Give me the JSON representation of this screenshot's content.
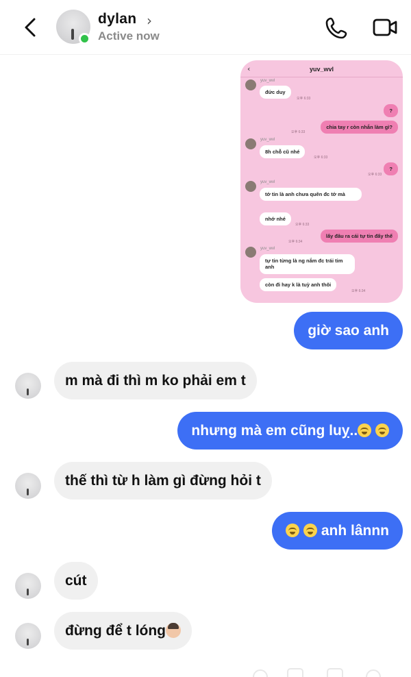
{
  "header": {
    "name": "dylan",
    "status": "Active now"
  },
  "shared_screenshot": {
    "title": "yuv_wvl",
    "messages": [
      {
        "dir": "in",
        "sender": "yuv_wvl",
        "text": "đức duy",
        "time": "오후 6:33"
      },
      {
        "dir": "out",
        "text": "?"
      },
      {
        "dir": "out",
        "text": "chia tay r còn nhắn làm gì?",
        "time": "오후 6:33"
      },
      {
        "dir": "in",
        "sender": "yuv_wvl",
        "text": "8h chỗ cũ nhé",
        "time": "오후 6:33"
      },
      {
        "dir": "out",
        "text": "?",
        "time": "오후 6:33"
      },
      {
        "dir": "in",
        "sender": "yuv_wvl",
        "text": "tớ tin là anh chưa quên đc tớ mà"
      },
      {
        "dir": "in",
        "text": "nhớ nhé",
        "time": "오후 6:33"
      },
      {
        "dir": "out",
        "text": "lấy đâu ra cái tự tin đấy thế",
        "time": "오후 6:34"
      },
      {
        "dir": "in",
        "sender": "yuv_wvl",
        "text": "tự tin từng là ng nắm đc trái tim anh"
      },
      {
        "dir": "in",
        "text": "còn đi hay k là tuỳ anh thôi",
        "time": "오후 6:34"
      }
    ]
  },
  "messages": [
    {
      "dir": "out",
      "text": "giờ sao anh"
    },
    {
      "dir": "in",
      "text": "m mà đi thì m ko phải em t"
    },
    {
      "dir": "out",
      "text": "nhưng mà em cũng luỵ..",
      "emoji": [
        "loudly-crying-face",
        "loudly-crying-face"
      ]
    },
    {
      "dir": "in",
      "text": "thế thì từ h làm gì đừng hỏi t"
    },
    {
      "dir": "out",
      "text": "anh lânnn",
      "emoji_before": [
        "loudly-crying-face",
        "loudly-crying-face"
      ]
    },
    {
      "dir": "in",
      "text": "cút"
    },
    {
      "dir": "in",
      "text": "đừng để t lóng",
      "emoji": [
        "person-shrugging"
      ]
    }
  ]
}
